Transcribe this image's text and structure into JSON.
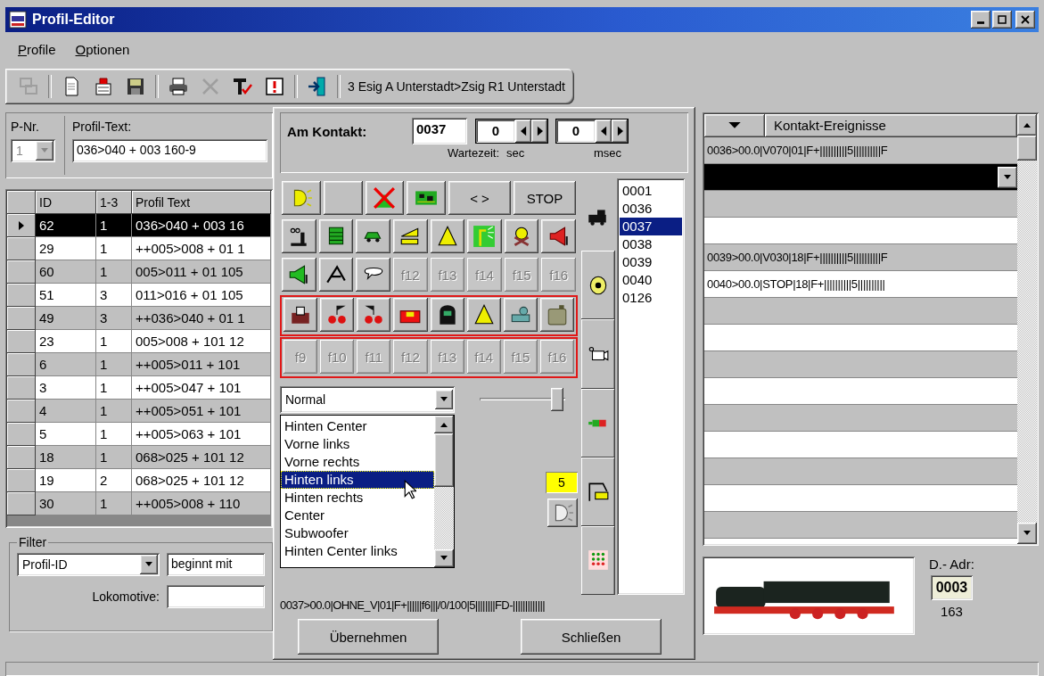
{
  "window": {
    "title": "Profil-Editor"
  },
  "menu": [
    {
      "label": "Profile"
    },
    {
      "label": "Optionen"
    }
  ],
  "toolbar": {
    "groups": [
      [
        {
          "disabled": true
        }
      ],
      [
        {
          "disabled": false
        },
        {
          "disabled": false
        },
        {
          "disabled": false
        }
      ],
      [
        {
          "disabled": false
        },
        {
          "disabled": true
        },
        {
          "disabled": false
        },
        {
          "disabled": false
        }
      ],
      [
        {
          "disabled": false
        }
      ]
    ],
    "route": "3 Esig A Unterstadt>Zsig R1 Unterstadt"
  },
  "profile": {
    "number_label": "P-Nr.",
    "number": "1",
    "number_disabled": true,
    "text_label": "Profil-Text:",
    "text": "036>040 + 003 160-9"
  },
  "table": {
    "columns": [
      "ID",
      "1-3",
      "Profil Text"
    ],
    "rows": [
      {
        "cells": [
          "62",
          "1",
          "036>040 + 003 16"
        ],
        "selected": true
      },
      {
        "cells": [
          "29",
          "1",
          "++005>008 + 01 1"
        ],
        "selected": false
      },
      {
        "cells": [
          "60",
          "1",
          "005>011 + 01 105"
        ],
        "selected": false
      },
      {
        "cells": [
          "51",
          "3",
          "011>016 + 01 105"
        ],
        "selected": false
      },
      {
        "cells": [
          "49",
          "3",
          "++036>040 + 01 1"
        ],
        "selected": false
      },
      {
        "cells": [
          "23",
          "1",
          "005>008 + 101 12"
        ],
        "selected": false
      },
      {
        "cells": [
          "6",
          "1",
          "++005>011 + 101"
        ],
        "selected": false
      },
      {
        "cells": [
          "3",
          "1",
          "++005>047 + 101"
        ],
        "selected": false
      },
      {
        "cells": [
          "4",
          "1",
          "++005>051 + 101"
        ],
        "selected": false
      },
      {
        "cells": [
          "5",
          "1",
          "++005>063 + 101"
        ],
        "selected": false
      },
      {
        "cells": [
          "18",
          "1",
          "068>025 + 101 12"
        ],
        "selected": false
      },
      {
        "cells": [
          "19",
          "2",
          "068>025 + 101 12"
        ],
        "selected": false
      },
      {
        "cells": [
          "30",
          "1",
          "++005>008 + 110"
        ],
        "selected": false
      }
    ]
  },
  "filter": {
    "title": "Filter",
    "field": "Profil-ID",
    "operator": "beginnt mit",
    "loco_label": "Lokomotive:"
  },
  "dialog": {
    "contact_label": "Am Kontakt:",
    "contact": "0037",
    "sec": "0",
    "msec": "0",
    "wait_label": "Wartezeit:",
    "sec_label": "sec",
    "msec_label": "msec",
    "function_rows": [
      {
        "highlighted": false,
        "buttons": [
          {
            "kind": "icon",
            "disabled": false
          },
          {
            "kind": "blank",
            "disabled": false
          },
          {
            "kind": "icon",
            "disabled": false
          },
          {
            "kind": "icon",
            "disabled": false
          },
          {
            "kind": "text",
            "label": "< >",
            "disabled": false
          },
          {
            "kind": "text",
            "label": "STOP",
            "disabled": false
          }
        ]
      },
      {
        "highlighted": false,
        "buttons": [
          {
            "kind": "icon",
            "disabled": false
          },
          {
            "kind": "icon",
            "disabled": false
          },
          {
            "kind": "icon",
            "disabled": false
          },
          {
            "kind": "icon",
            "disabled": false
          },
          {
            "kind": "icon",
            "disabled": false
          },
          {
            "kind": "icon",
            "disabled": false
          },
          {
            "kind": "icon",
            "disabled": false
          },
          {
            "kind": "icon",
            "disabled": false
          }
        ]
      },
      {
        "highlighted": false,
        "buttons": [
          {
            "kind": "icon",
            "disabled": false
          },
          {
            "kind": "icon",
            "disabled": false
          },
          {
            "kind": "icon",
            "disabled": false
          },
          {
            "kind": "text",
            "label": "f12",
            "disabled": true
          },
          {
            "kind": "text",
            "label": "f13",
            "disabled": true
          },
          {
            "kind": "text",
            "label": "f14",
            "disabled": true
          },
          {
            "kind": "text",
            "label": "f15",
            "disabled": true
          },
          {
            "kind": "text",
            "label": "f16",
            "disabled": true
          }
        ]
      },
      {
        "highlighted": true,
        "buttons": [
          {
            "kind": "icon",
            "disabled": false
          },
          {
            "kind": "icon",
            "disabled": false
          },
          {
            "kind": "icon",
            "disabled": false
          },
          {
            "kind": "icon",
            "disabled": false
          },
          {
            "kind": "icon",
            "disabled": false
          },
          {
            "kind": "icon",
            "disabled": false
          },
          {
            "kind": "icon",
            "disabled": false
          },
          {
            "kind": "icon",
            "disabled": false
          }
        ]
      },
      {
        "highlighted": true,
        "buttons": [
          {
            "kind": "text",
            "label": "f9",
            "disabled": true
          },
          {
            "kind": "text",
            "label": "f10",
            "disabled": true
          },
          {
            "kind": "text",
            "label": "f11",
            "disabled": true
          },
          {
            "kind": "text",
            "label": "f12",
            "disabled": true
          },
          {
            "kind": "text",
            "label": "f13",
            "disabled": true
          },
          {
            "kind": "text",
            "label": "f14",
            "disabled": true
          },
          {
            "kind": "text",
            "label": "f15",
            "disabled": true
          },
          {
            "kind": "text",
            "label": "f16",
            "disabled": true
          }
        ]
      }
    ],
    "side_tabs": [
      {
        "selected": true
      },
      {
        "selected": false
      },
      {
        "selected": false
      },
      {
        "selected": false
      },
      {
        "selected": false
      },
      {
        "selected": false
      }
    ],
    "addresses": [
      {
        "label": "0001",
        "selected": false
      },
      {
        "label": "0036",
        "selected": false
      },
      {
        "label": "0037",
        "selected": true
      },
      {
        "label": "0038",
        "selected": false
      },
      {
        "label": "0039",
        "selected": false
      },
      {
        "label": "0040",
        "selected": false
      },
      {
        "label": "0126",
        "selected": false
      }
    ],
    "mode": "Normal",
    "channel_options": [
      {
        "label": "Hinten Center",
        "selected": false
      },
      {
        "label": "Vorne links",
        "selected": false
      },
      {
        "label": "Vorne rechts",
        "selected": false
      },
      {
        "label": "Hinten links",
        "selected": true
      },
      {
        "label": "Hinten rechts",
        "selected": false
      },
      {
        "label": "Center",
        "selected": false
      },
      {
        "label": "Subwoofer",
        "selected": false
      },
      {
        "label": "Hinten Center links",
        "selected": false
      }
    ],
    "volume": {
      "level": 1
    },
    "volume_value": "5",
    "event_text": "0037>00.0|OHNE_V|01|F+||||||f6|||/0/100|5||||||||FD-|||||||||||||",
    "buttons": [
      "Übernehmen",
      "Schließen"
    ]
  },
  "events": {
    "title": "Kontakt-Ereignisse",
    "rows": [
      {
        "text": "0036>00.0|V070|01|F+||||||||||5||||||||||F",
        "selected": false
      },
      {
        "selected": true
      },
      {
        "selected": false
      },
      {
        "selected": false
      },
      {
        "text": "0039>00.0|V030|18|F+||||||||||5||||||||||F",
        "selected": false
      },
      {
        "text": "0040>00.0|STOP|18|F+||||||||||5||||||||||",
        "selected": false
      },
      {
        "selected": false
      },
      {
        "selected": false
      },
      {
        "selected": false
      },
      {
        "selected": false
      },
      {
        "selected": false
      },
      {
        "selected": false
      },
      {
        "selected": false
      },
      {
        "selected": false
      },
      {
        "selected": false
      }
    ]
  },
  "decoder": {
    "label": "D.- Adr:",
    "address": "0003",
    "number": "163"
  }
}
